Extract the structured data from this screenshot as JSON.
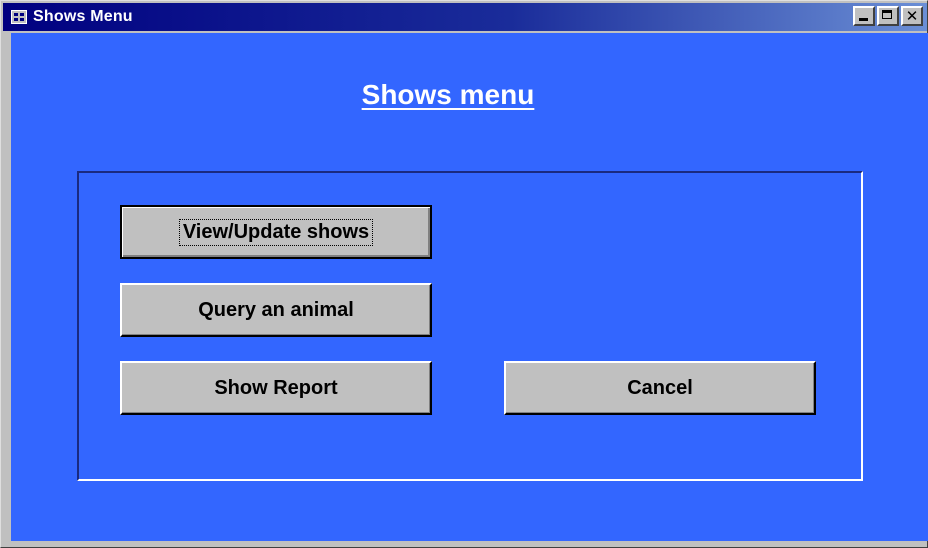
{
  "window": {
    "title": "Shows Menu",
    "icon": "form-icon",
    "caption_buttons": {
      "minimize": "minimize-icon",
      "maximize": "maximize-icon",
      "close_glyph": "✕"
    }
  },
  "form": {
    "title": "Shows menu",
    "background_color": "#3366ff",
    "buttons": {
      "view_update_shows": "View/Update shows",
      "query_animal": "Query an animal",
      "show_report": "Show Report",
      "cancel": "Cancel"
    }
  }
}
